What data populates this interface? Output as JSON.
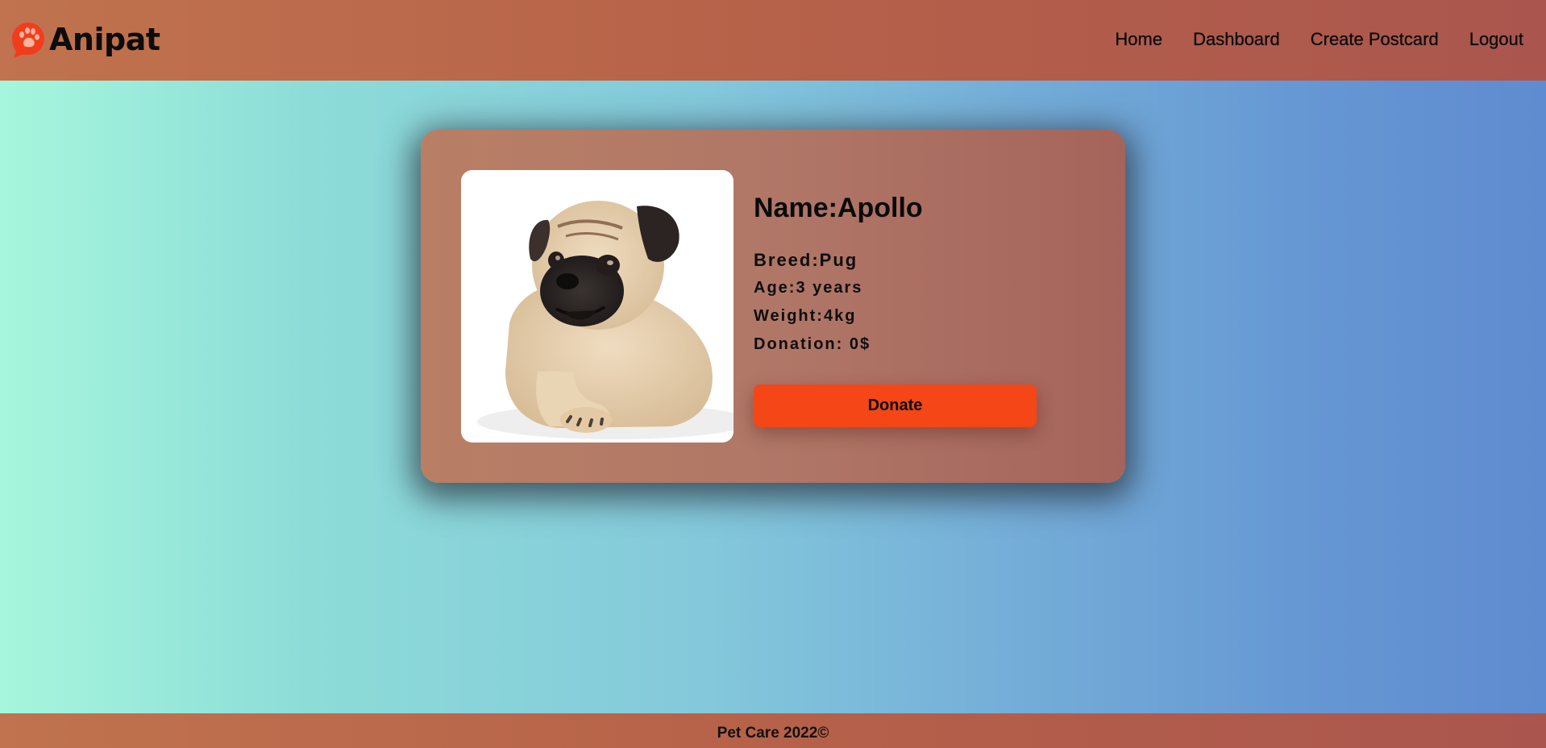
{
  "header": {
    "logo_text": "Anipat",
    "logo_icon": "paw-chat-bubble-icon",
    "nav": [
      {
        "label": "Home"
      },
      {
        "label": "Dashboard"
      },
      {
        "label": "Create Postcard"
      },
      {
        "label": "Logout"
      }
    ]
  },
  "pet_card": {
    "photo_alt": "pug-puppy",
    "name": "Name:Apollo",
    "breed": "Breed:Pug",
    "age": "Age:3 years",
    "weight": "Weight:4kg",
    "donation": "Donation: 0$",
    "donate_label": "Donate"
  },
  "footer": {
    "text": "Pet Care 2022©"
  },
  "colors": {
    "accent": "#f44617",
    "header_bg": "#b66149",
    "card_bg": "#b07767"
  }
}
